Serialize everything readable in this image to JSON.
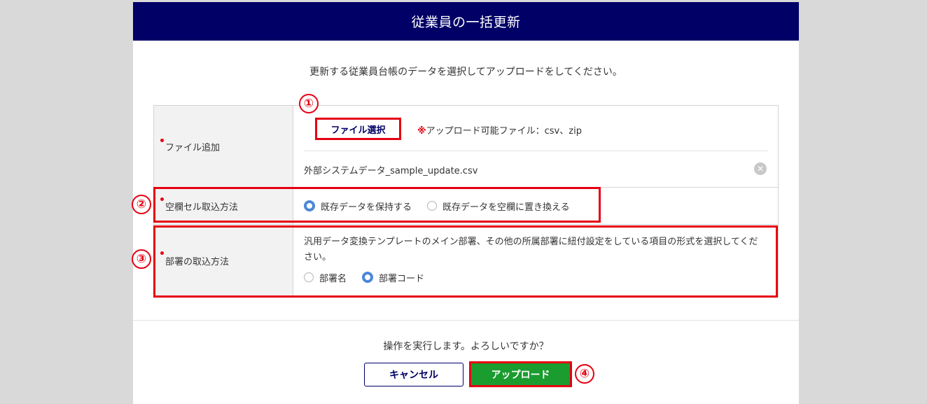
{
  "dialog": {
    "title": "従業員の一括更新",
    "instruction": "更新する従業員台帳のデータを選択してアップロードをしてください。"
  },
  "form": {
    "file_row": {
      "label": "ファイル追加",
      "button_label": "ファイル選択",
      "note_mark": "※",
      "note_text": "アップロード可能ファイル：csv、zip",
      "selected_file": "外部システムデータ_sample_update.csv",
      "clear_icon": "close-circle-icon"
    },
    "blank_cell_row": {
      "label": "空欄セル取込方法",
      "options": [
        {
          "label": "既存データを保持する",
          "checked": true
        },
        {
          "label": "既存データを空欄に置き換える",
          "checked": false
        }
      ]
    },
    "dept_row": {
      "label": "部署の取込方法",
      "description": "汎用データ変換テンプレートのメイン部署、その他の所属部署に紐付設定をしている項目の形式を選択してください。",
      "options": [
        {
          "label": "部署名",
          "checked": false
        },
        {
          "label": "部署コード",
          "checked": true
        }
      ]
    }
  },
  "footer": {
    "confirm_text": "操作を実行します。よろしいですか？",
    "cancel_label": "キャンセル",
    "upload_label": "アップロード"
  },
  "annotations": {
    "n1": "①",
    "n2": "②",
    "n3": "③",
    "n4": "④"
  },
  "colors": {
    "header_bg": "#000066",
    "highlight": "#e60012",
    "upload_bg": "#1a9c2f",
    "radio_checked": "#4b87d9"
  }
}
